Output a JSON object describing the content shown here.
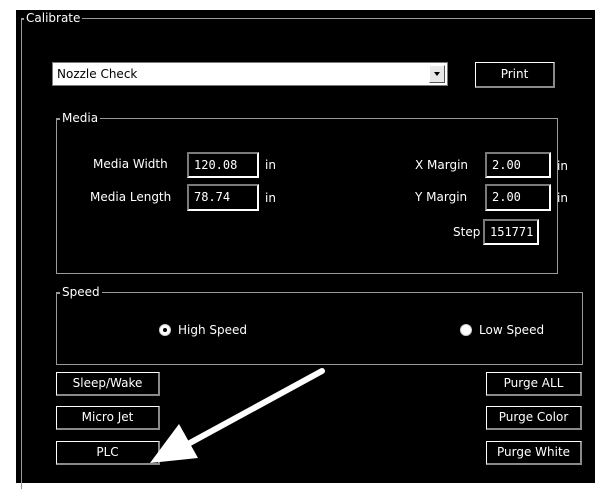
{
  "calibrate": {
    "title": "Calibrate",
    "pattern_select": {
      "value": "Nozzle Check"
    },
    "print_label": "Print"
  },
  "media": {
    "title": "Media",
    "width_label": "Media Width",
    "width_value": "120.08",
    "width_unit": "in",
    "length_label": "Media Length",
    "length_value": "78.74",
    "length_unit": "in",
    "x_margin_label": "X Margin",
    "x_margin_value": "2.00",
    "x_margin_unit": "in",
    "y_margin_label": "Y Margin",
    "y_margin_value": "2.00",
    "y_margin_unit": "in",
    "step_label": "Step",
    "step_value": "151771"
  },
  "speed": {
    "title": "Speed",
    "high_label": "High Speed",
    "low_label": "Low Speed",
    "selected": "High Speed"
  },
  "buttons": {
    "sleep_wake": "Sleep/Wake",
    "micro_jet": "Micro Jet",
    "plc": "PLC",
    "purge_all": "Purge ALL",
    "purge_color": "Purge Color",
    "purge_white": "Purge White"
  },
  "colors": {
    "background": "#000000",
    "text": "#ffffff",
    "border": "#9a9a9a",
    "annotation_arrow": "#ffffff"
  },
  "icons": [
    "chevron-down-icon",
    "radio-selected-icon",
    "radio-unselected-icon",
    "arrow-annotation-icon"
  ]
}
